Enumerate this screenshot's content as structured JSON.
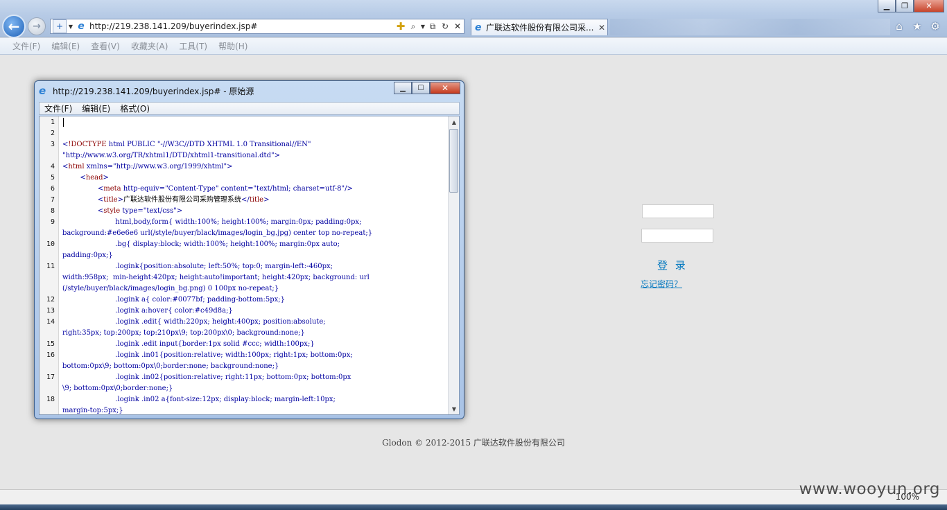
{
  "browser": {
    "url": "http://219.238.141.209/buyerindex.jsp#",
    "tab_title": "广联达软件股份有限公司采...",
    "menu": [
      "文件(F)",
      "编辑(E)",
      "查看(V)",
      "收藏夹(A)",
      "工具(T)",
      "帮助(H)"
    ],
    "zoom": "100%",
    "accent_color": "#1f62b8"
  },
  "page": {
    "login_label": "登 录",
    "forgot_label": "忘记密码？",
    "footer": "Glodon © 2012-2015 广联达软件股份有限公司"
  },
  "source_window": {
    "title": "http://219.238.141.209/buyerindex.jsp# - 原始源",
    "menu": [
      "文件(F)",
      "编辑(E)",
      "格式(O)"
    ],
    "line_numbers": [
      "1",
      "2",
      "3",
      "4",
      "5",
      "6",
      "7",
      "8",
      "9",
      "10",
      "11",
      "12",
      "13",
      "14",
      "15",
      "16",
      "17",
      "18"
    ],
    "lines": [
      "",
      "",
      "<!DOCTYPE html PUBLIC \"-//W3C//DTD XHTML 1.0 Transitional//EN\"",
      "\"http://www.w3.org/TR/xhtml1/DTD/xhtml1-transitional.dtd\">",
      "<html xmlns=\"http://www.w3.org/1999/xhtml\">",
      "        <head>",
      "                <meta http-equiv=\"Content-Type\" content=\"text/html; charset=utf-8\"/>",
      "                <title>广联达软件股份有限公司采购管理系统</title>",
      "                <style type=\"text/css\">",
      "                        html,body,form{ width:100%; height:100%; margin:0px; padding:0px;",
      "background:#e6e6e6 url(/style/buyer/black/images/login_bg.jpg) center top no-repeat;}",
      "                        .bg{ display:block; width:100%; height:100%; margin:0px auto;",
      "padding:0px;}",
      "                        .logink{position:absolute; left:50%; top:0; margin-left:-460px;",
      "width:958px;  min-height:420px; height:auto!important; height:420px; background: url",
      "(/style/buyer/black/images/login_bg.png) 0 100px no-repeat;}",
      "                        .logink a{ color:#0077bf; padding-bottom:5px;}",
      "                        .logink a:hover{ color:#c49d8a;}",
      "                        .logink .edit{ width:220px; height:400px; position:absolute;",
      "right:35px; top:200px; top:210px\\9; top:200px\\0; background:none;}",
      "                        .logink .edit input{border:1px solid #ccc; width:100px;}",
      "                        .logink .in01{position:relative; width:100px; right:1px; bottom:0px;",
      "bottom:0px\\9; bottom:0px\\0;border:none; background:none;}",
      "                        .logink .in02{position:relative; right:11px; bottom:0px; bottom:0px",
      "\\9; bottom:0px\\0;border:none;}",
      "                        .logink .in02 a{font-size:12px; display:block; margin-left:10px;",
      "margin-top:5px;}"
    ]
  },
  "watermark": "www.wooyun.org"
}
